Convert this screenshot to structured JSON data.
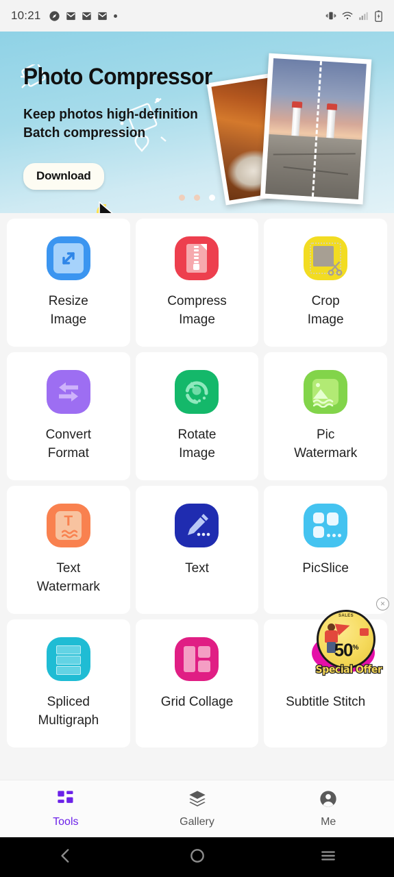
{
  "status_bar": {
    "time": "10:21",
    "left_icons": [
      "compass-icon",
      "mail-icon",
      "mail-icon",
      "mail-icon",
      "dot-icon"
    ],
    "right_icons": [
      "vibrate-icon",
      "wifi-icon",
      "signal-icon",
      "battery-charging-icon"
    ]
  },
  "banner": {
    "title": "Photo Compressor",
    "subtitle": "Keep photos high-definition\nBatch compression",
    "download_label": "Download",
    "dots_total": 3,
    "active_dot": 3,
    "bg_start": "#8fd2e6",
    "bg_end": "#e2f2f7"
  },
  "tools": [
    {
      "label": "Resize\nImage",
      "icon": "resize-icon",
      "color": "#3b95f0"
    },
    {
      "label": "Compress\nImage",
      "icon": "compress-file-icon",
      "color": "#ed3f4e"
    },
    {
      "label": "Crop\nImage",
      "icon": "crop-scissors-icon",
      "color": "#f2dc22"
    },
    {
      "label": "Convert\nFormat",
      "icon": "convert-arrows-icon",
      "color": "#9d6ef2"
    },
    {
      "label": "Rotate\nImage",
      "icon": "rotate-icon",
      "color": "#14b86a"
    },
    {
      "label": "Pic\nWatermark",
      "icon": "picture-watermark-icon",
      "color": "#82d44a"
    },
    {
      "label": "Text\nWatermark",
      "icon": "text-watermark-icon",
      "color": "#f9814f"
    },
    {
      "label": "Text",
      "icon": "pencil-icon",
      "color": "#1f2cb0"
    },
    {
      "label": "PicSlice",
      "icon": "slice-grid-icon",
      "color": "#44c3f0"
    },
    {
      "label": "Spliced\nMultigraph",
      "icon": "stacked-rows-icon",
      "color": "#1fbcd4"
    },
    {
      "label": "Grid Collage",
      "icon": "collage-grid-icon",
      "color": "#e01e84"
    },
    {
      "label": "Subtitle Stitch",
      "icon": "subtitle-stitch-icon",
      "color": "#ffffff"
    }
  ],
  "ad": {
    "sales_text": "SALES",
    "discount": "50",
    "percent_symbol": "%",
    "ribbon": "Special Offer",
    "close_label": "×"
  },
  "bottom_nav": {
    "items": [
      {
        "label": "Tools",
        "icon": "grid-icon",
        "active": true
      },
      {
        "label": "Gallery",
        "icon": "layers-icon",
        "active": false
      },
      {
        "label": "Me",
        "icon": "person-icon",
        "active": false
      }
    ],
    "active_color": "#6b21e8"
  },
  "android_nav": {
    "back": "back-icon",
    "home": "home-icon",
    "recents": "recents-icon"
  }
}
